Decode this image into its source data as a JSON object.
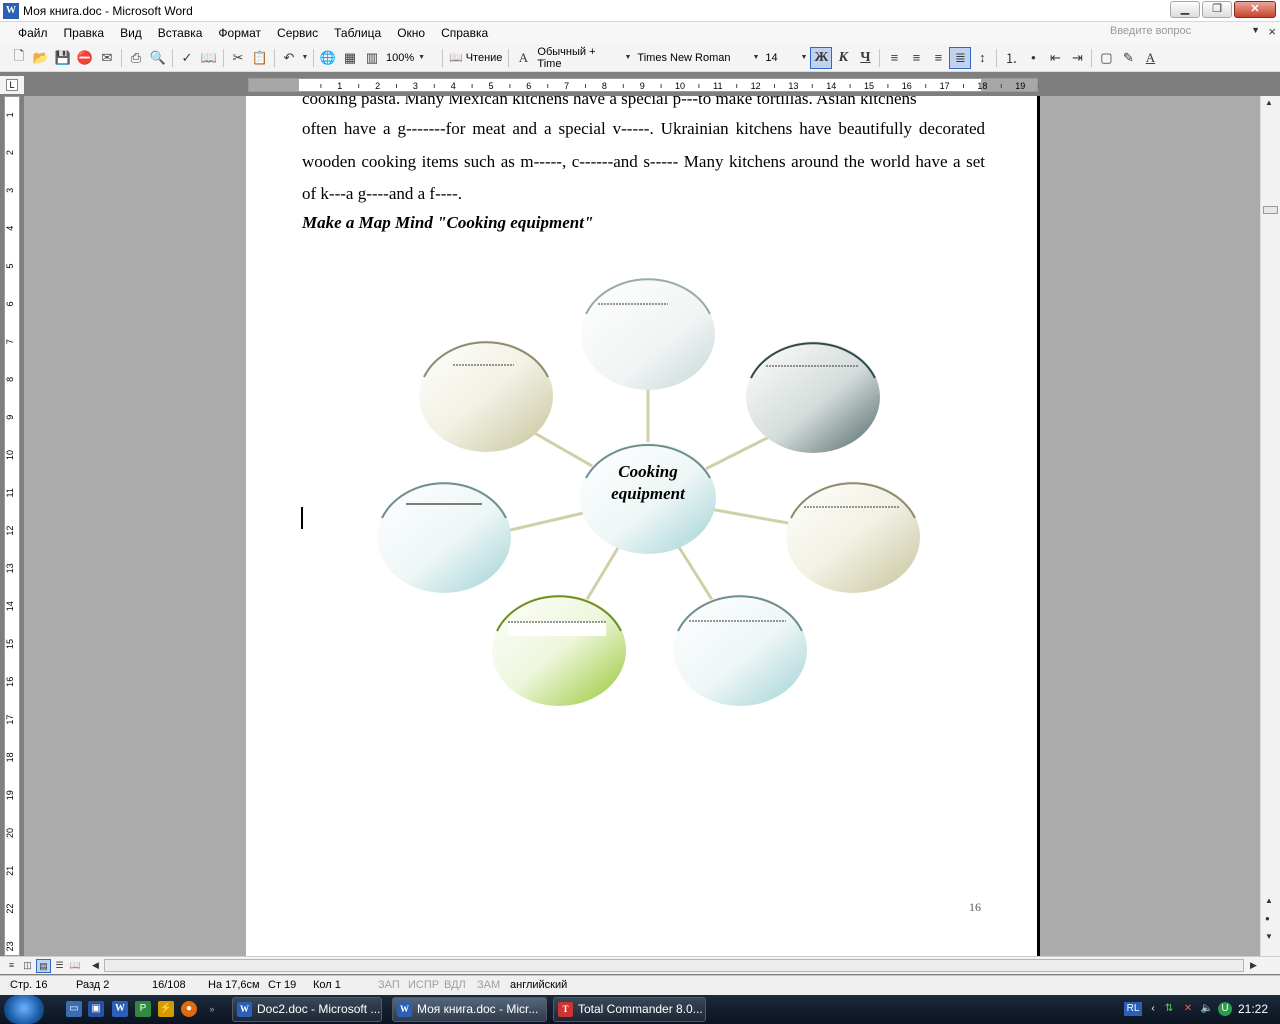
{
  "window": {
    "title": "Моя книга.doc - Microsoft Word",
    "app_icon": "W"
  },
  "menu": {
    "items": [
      "Файл",
      "Правка",
      "Вид",
      "Вставка",
      "Формат",
      "Сервис",
      "Таблица",
      "Окно",
      "Справка"
    ],
    "ask_placeholder": "Введите вопрос"
  },
  "toolbar": {
    "zoom": "100%",
    "reading_label": "Чтение",
    "style": "Обычный + Time",
    "font": "Times New Roman",
    "size": "14",
    "bold": "Ж",
    "italic": "К",
    "underline": "Ч"
  },
  "document": {
    "lines": [
      "cooking pasta. Many Mexican kitchens have a special p---to make tortillas. Asian kitchens",
      "often have a g-------for meat and a special v-----. Ukrainian kitchens have beautifully decorated",
      "wooden cooking items such as m-----, c------and s----- Many kitchens around the world have a set",
      "of k---a g----and a f----."
    ],
    "heading": "Make a Map Mind \"Cooking equipment\"",
    "center_label_1": "Cooking",
    "center_label_2": "equipment",
    "page_number": "16"
  },
  "status": {
    "page": "Стр. 16",
    "section": "Разд 2",
    "pages": "16/108",
    "at": "На 17,6см",
    "line": "Ст 19",
    "col": "Кол 1",
    "rec": "ЗАП",
    "trk": "ИСПР",
    "ext": "ВДЛ",
    "ovr": "ЗАМ",
    "lang": "английский"
  },
  "taskbar": {
    "tasks": [
      "Doc2.doc - Microsoft ...",
      "Моя книга.doc - Micr...",
      "Total Commander 8.0..."
    ],
    "lang_indicator": "RL",
    "clock": "21:22"
  },
  "colors": {
    "accent": "#316ac5",
    "node_teal": "#a8d8da",
    "node_khaki": "#c8c6a0",
    "node_slate": "#4f6b6a",
    "node_green": "#9ccb3b",
    "connector": "#d0cfa8"
  }
}
